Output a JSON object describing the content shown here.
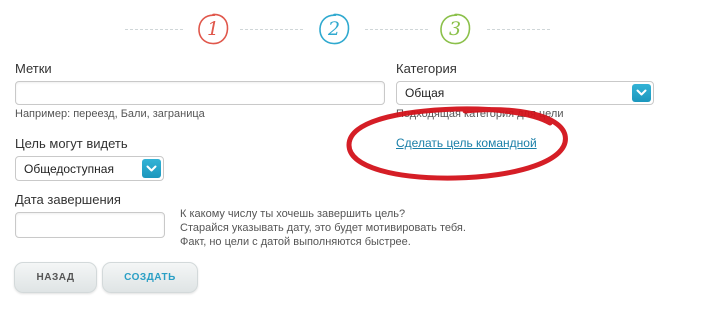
{
  "steps": [
    {
      "number": "1",
      "color": "#e0574b"
    },
    {
      "number": "2",
      "color": "#2fa9cf"
    },
    {
      "number": "3",
      "color": "#8bc04a"
    }
  ],
  "tags": {
    "label": "Метки",
    "value": "",
    "hint": "Например: переезд, Бали, заграница"
  },
  "category": {
    "label": "Категория",
    "selected": "Общая",
    "hint": "Подходящая категория для цели"
  },
  "team_link": "Сделать цель командной",
  "visibility": {
    "label": "Цель могут видеть",
    "selected": "Общедоступная"
  },
  "end_date": {
    "label": "Дата завершения",
    "value": "",
    "hint_lines": [
      "К какому числу ты хочешь завершить цель?",
      "Старайся указывать дату, это будет мотивировать тебя.",
      "Факт, но цели с датой выполняются быстрее."
    ]
  },
  "buttons": {
    "back": "НАЗАД",
    "create": "СОЗДАТЬ"
  },
  "colors": {
    "accent": "#2a9fc5",
    "link": "#1a7fa8",
    "annotation": "#d3121a"
  }
}
